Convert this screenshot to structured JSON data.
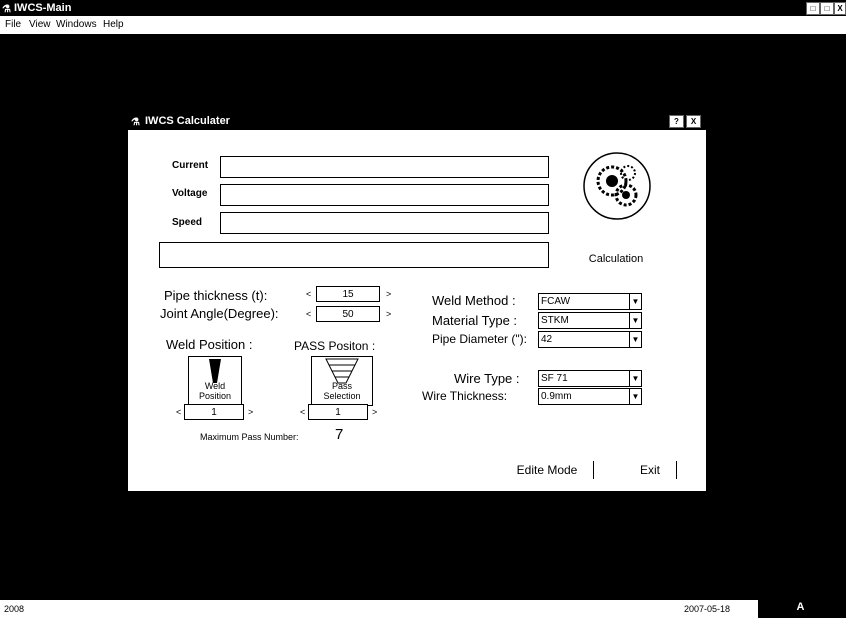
{
  "main_window": {
    "title": "IWCS-Main",
    "menu": [
      "File",
      "View",
      "Windows",
      "Help"
    ],
    "caption_buttons": [
      "?",
      "□",
      "X"
    ]
  },
  "dialog": {
    "title": "IWCS Calculater",
    "fields": {
      "current_label": "Current",
      "voltage_label": "Voltage",
      "speed_label": "Speed"
    },
    "calculation_button": "Calculation",
    "pipe_thickness_label": "Pipe thickness (t):",
    "pipe_thickness_value": "15",
    "joint_angle_label": "Joint Angle(Degree):",
    "joint_angle_value": "50",
    "weld_method_label": "Weld Method :",
    "weld_method_value": "FCAW",
    "material_type_label": "Material Type :",
    "material_type_value": "STKM",
    "pipe_diameter_label": "Pipe Diameter (\"):",
    "pipe_diameter_value": "42",
    "weld_position_label": "Weld Position :",
    "pass_position_label": "PASS Positon :",
    "weld_position_icon_label": "Weld\nPosition",
    "pass_selection_icon_label": "Pass\nSelection",
    "weld_position_value": "1",
    "pass_selection_value": "1",
    "wire_type_label": "Wire Type :",
    "wire_type_value": "SF 71",
    "wire_thickness_label": "Wire Thickness:",
    "wire_thickness_value": "0.9mm",
    "max_pass_label": "Maximum Pass Number:",
    "max_pass_value": "7",
    "edit_mode_button": "Edite Mode",
    "exit_button": "Exit",
    "help_button": "?",
    "close_button": "X"
  },
  "status": {
    "left_text": "2008",
    "right_text": "2007-05-18",
    "tray_text": "A"
  }
}
